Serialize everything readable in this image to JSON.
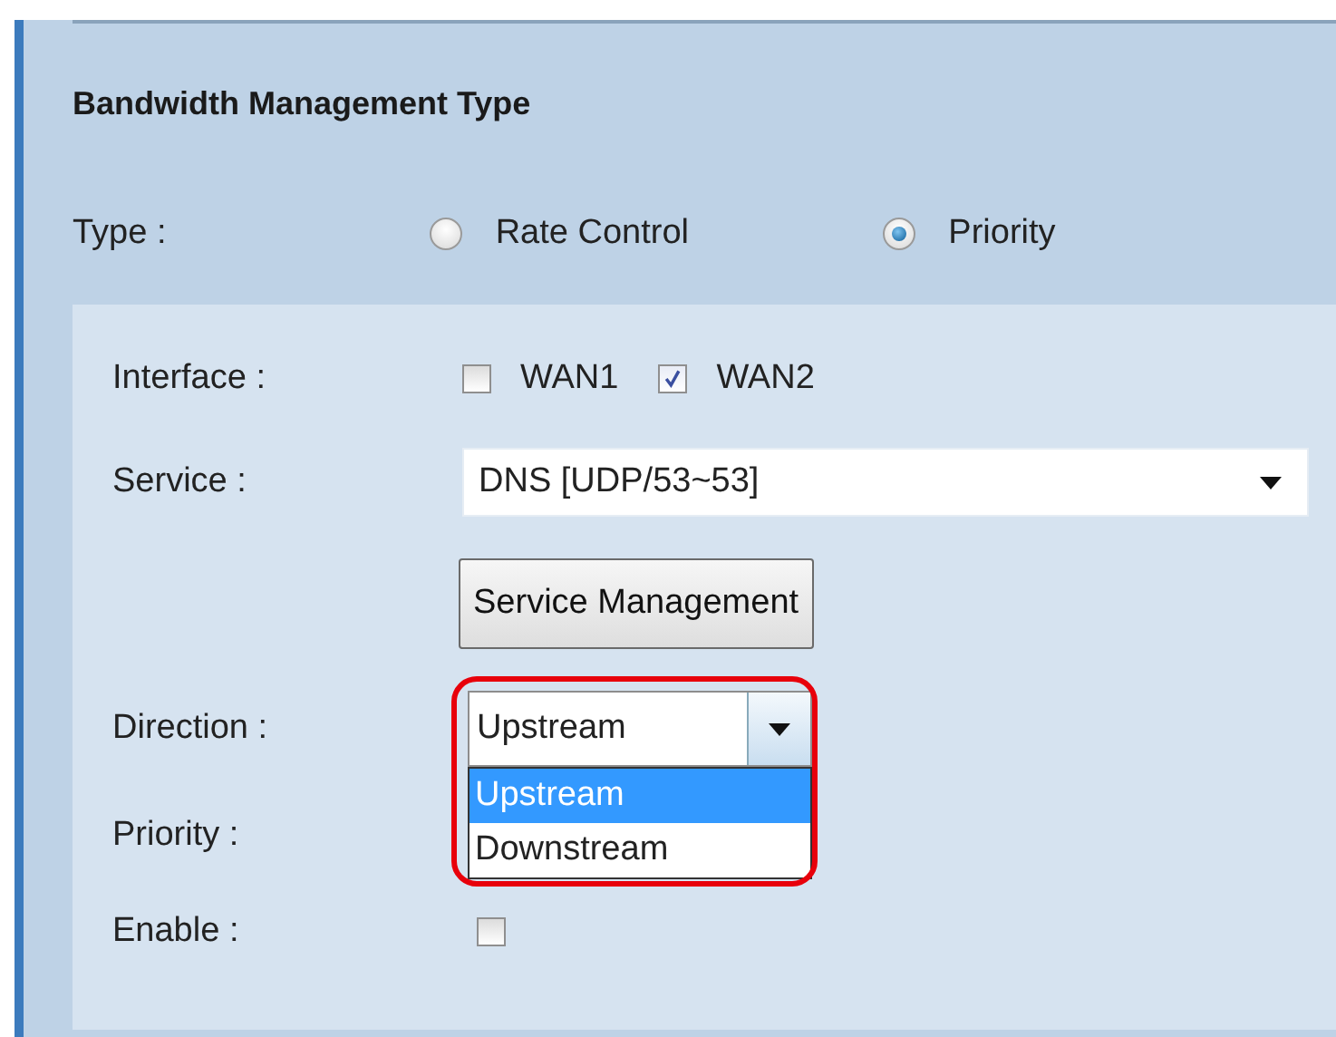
{
  "section": {
    "title": "Bandwidth Management Type"
  },
  "type_row": {
    "label": "Type :",
    "options": [
      {
        "label": "Rate Control",
        "selected": false
      },
      {
        "label": "Priority",
        "selected": true
      }
    ]
  },
  "fields": [
    {
      "kind": "checkboxes",
      "label": "Interface :",
      "options": [
        {
          "label": "WAN1",
          "checked": false
        },
        {
          "label": "WAN2",
          "checked": true
        }
      ]
    },
    {
      "kind": "select",
      "label": "Service :",
      "value": "DNS [UDP/53~53]"
    },
    {
      "kind": "button",
      "text": "Service Management"
    },
    {
      "kind": "dropdown",
      "label": "Direction :",
      "value": "Upstream",
      "highlighted": true,
      "options": [
        {
          "label": "Upstream",
          "selected": true
        },
        {
          "label": "Downstream",
          "selected": false
        }
      ]
    },
    {
      "kind": "covered",
      "label": "Priority :"
    },
    {
      "kind": "checkbox",
      "label": "Enable :",
      "checked": false
    }
  ]
}
